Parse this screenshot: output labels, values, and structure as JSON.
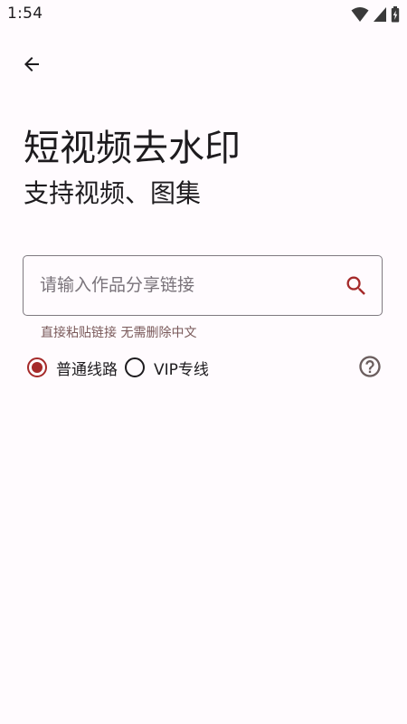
{
  "status_bar": {
    "time": "1:54",
    "icons": [
      "wifi-icon",
      "signal-icon",
      "battery-icon"
    ]
  },
  "header": {
    "back_icon": "arrow-back-icon"
  },
  "title": "短视频去水印",
  "subtitle": "支持视频、图集",
  "search": {
    "placeholder": "请输入作品分享链接",
    "value": "",
    "icon": "search-icon"
  },
  "helper_text": "直接粘贴链接 无需删除中文",
  "routes": [
    {
      "label": "普通线路",
      "selected": true
    },
    {
      "label": "VIP专线",
      "selected": false
    }
  ],
  "help_icon": "help-icon",
  "colors": {
    "accent": "#a52a2a",
    "background": "#fffbfe",
    "text": "#1d1b1e",
    "outline": "#7f7a80",
    "helper": "#7a5a5a"
  }
}
